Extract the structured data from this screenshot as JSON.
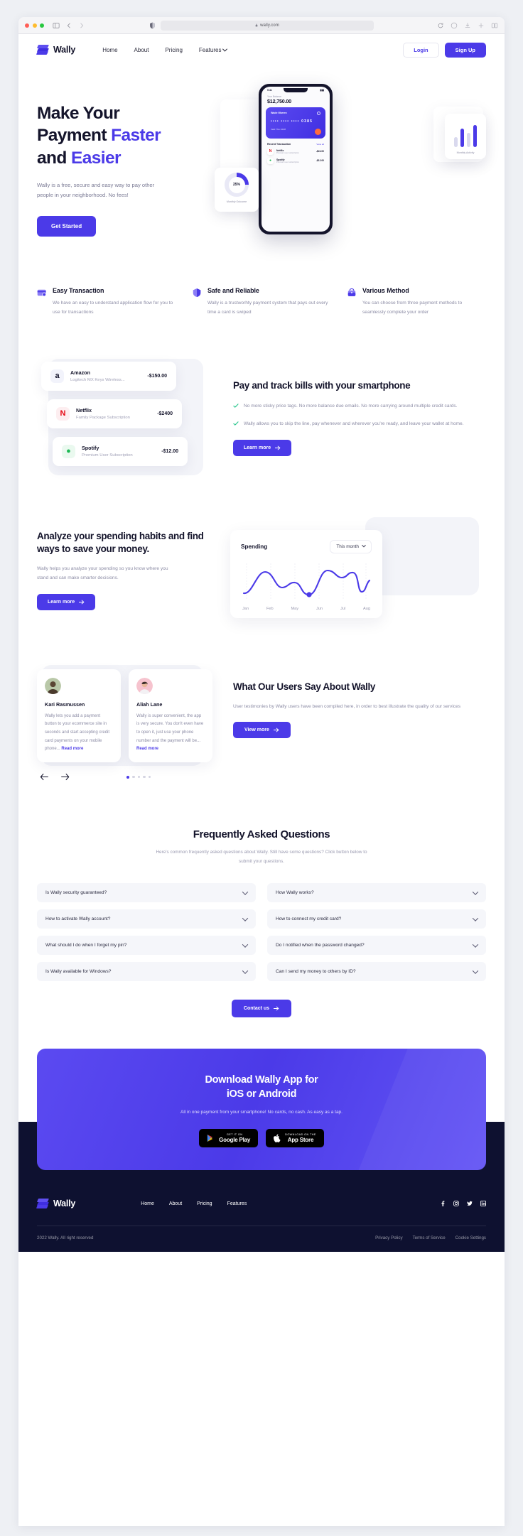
{
  "browser": {
    "url": "wally.com",
    "lock_icon": "lock-icon",
    "reload_icon": "reload-icon"
  },
  "nav": {
    "brand": "Wally",
    "links": [
      {
        "label": "Home"
      },
      {
        "label": "About"
      },
      {
        "label": "Pricing"
      },
      {
        "label": "Features"
      }
    ],
    "login": "Login",
    "signup": "Sign Up"
  },
  "hero": {
    "title_l1": "Make Your",
    "title_l2a": "Payment ",
    "title_l2b": "Faster",
    "title_l3a": "and ",
    "title_l3b": "Easier",
    "paragraph": "Wally is a free, secure and easy way to pay other people in your neighborhood. No fees!",
    "cta": "Get Started",
    "phone": {
      "status_time": "9:41",
      "balance_label": "Your Balance",
      "balance_value": "$12,750.00",
      "card_name": "Wade Warren",
      "card_number": "••••  ••••  ••••  0385",
      "card_valid": "Valid Thru   04/28",
      "recent_label": "Recent Transaction",
      "view_all": "View all",
      "tx": [
        {
          "icon": "netflix-icon",
          "title": "Netflix",
          "sub": "Premium user subscription",
          "amount": "-$24.00"
        },
        {
          "icon": "spotify-icon",
          "title": "Spotify",
          "sub": "Premium user subscription",
          "amount": "-$12.00"
        }
      ]
    },
    "donut": {
      "value": "25%",
      "caption": "Monthly Outcome"
    },
    "activity": {
      "caption": "Monthly Activity"
    }
  },
  "features": [
    {
      "icon": "card-icon",
      "title": "Easy Transaction",
      "text": "We have an easy to understand application flow for you to use for transactions"
    },
    {
      "icon": "shield-icon",
      "title": "Safe and Reliable",
      "text": "Wally is a trustworhty payment system that pays out every time a card is swiped"
    },
    {
      "icon": "wallet-icon",
      "title": "Various Method",
      "text": "You can choose from three payment methods to seamlessly complete your order"
    }
  ],
  "bills": {
    "rows": [
      {
        "icon": "amazon-icon",
        "title": "Amazon",
        "sub": "Logitech MX Keys Wireless...",
        "amount": "-$150.00"
      },
      {
        "icon": "netflix-icon",
        "title": "Netflix",
        "sub": "Family Package Subscription",
        "amount": "-$2400"
      },
      {
        "icon": "spotify-icon",
        "title": "Spotify",
        "sub": "Premium User Subscription",
        "amount": "-$12.00"
      }
    ],
    "title": "Pay and track bills with your smartphone",
    "points": [
      "No more sticky price tags. No more balance due emails. No more carrying around multiple credit cards.",
      "Wally allows you to skip the line, pay whenever and wherever you're ready, and leave your wallet at home."
    ],
    "cta": "Learn more"
  },
  "analyze": {
    "title": "Analyze your spending habits and find ways to save your money.",
    "text": "Wally helps you analyze your spending so you know where you stand and can make smarter decisions.",
    "cta": "Learn more",
    "card_title": "Spending",
    "card_select": "This month"
  },
  "chart_data": {
    "type": "line",
    "title": "Spending",
    "xlabel": "",
    "ylabel": "",
    "categories": [
      "Jan",
      "Feb",
      "May",
      "Jun",
      "Jul",
      "Aug"
    ],
    "values": [
      22,
      74,
      44,
      16,
      80,
      72,
      30,
      62
    ],
    "x": [
      0,
      60,
      120,
      180,
      240,
      300,
      360,
      420
    ],
    "ylim": [
      0,
      100
    ],
    "grid": true,
    "legend": "none",
    "highlight_point": {
      "x": 180,
      "y": 16,
      "label": "May"
    },
    "line_color": "#4b3ae8"
  },
  "testimonials": {
    "items": [
      {
        "avatar": "avatar-kari",
        "name": "Kari Rasmussen",
        "quote": "Wally lets you add a payment button to your ecommerce site in seconds and start accepting credit card payments on your mobile phone...",
        "read_more": "Read more"
      },
      {
        "avatar": "avatar-aliah",
        "name": "Aliah Lane",
        "quote": "Wally is super convenient, the app is very secure. You don't even have to open it, just use your phone number and the payment will be...",
        "read_more": "Read more"
      }
    ],
    "prev_icon": "arrow-left-icon",
    "next_icon": "arrow-right-icon",
    "dot_count": 5,
    "active_dot": 0,
    "title": "What Our Users Say About Wally",
    "text": "User testimonies by Wally users have been compiled here, in order to best illustrate the quality of our services",
    "cta": "View more"
  },
  "faq": {
    "title": "Frequently Asked Questions",
    "subtitle": "Here's common frequently asked questions about Wally. Still have some questions? Click button below to submit your questions.",
    "items": [
      "Is Wally security guaranteed?",
      "How Wally works?",
      "How to activate Wally account?",
      "How to connect my credit card?",
      "What should I do when I forget my pin?",
      "Do I notified when the password changed?",
      "Is Wally available for Windows?",
      "Can I send my money to others by ID?"
    ],
    "cta": "Contact us"
  },
  "cta": {
    "title_l1": "Download Wally App for",
    "title_l2": "iOS or Android",
    "subtitle": "All in one payment from your smartphone! No cards, no cash. As easy as a tap.",
    "stores": [
      {
        "icon": "google-play-icon",
        "small": "Get it on",
        "big": "Google Play"
      },
      {
        "icon": "apple-icon",
        "small": "Download on the",
        "big": "App Store"
      }
    ]
  },
  "footer": {
    "brand": "Wally",
    "links": [
      "Home",
      "About",
      "Pricing",
      "Features"
    ],
    "social": [
      "facebook-icon",
      "instagram-icon",
      "twitter-icon",
      "linkedin-icon"
    ],
    "copyright": "2022 Wally. All right reserved",
    "legal": [
      "Privacy Policy",
      "Terms of Service",
      "Cookie Settings"
    ]
  },
  "colors": {
    "accent": "#4b3ae8",
    "dark": "#14142b",
    "footer": "#0e1130",
    "muted": "#8c8ca5"
  }
}
